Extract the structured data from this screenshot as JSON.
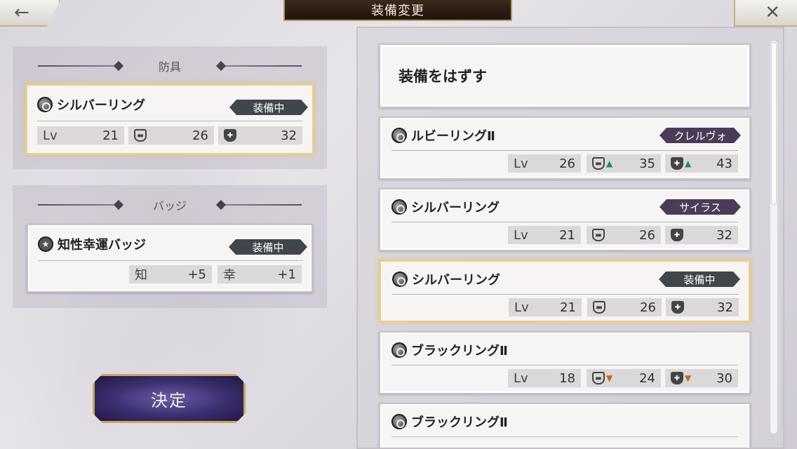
{
  "header": {
    "title": "装備変更",
    "back_icon": "←",
    "close_icon": "✕"
  },
  "armor_section": {
    "title": "防具",
    "card": {
      "name": "シルバーリング",
      "tag": "装備中",
      "lv_label": "Lv",
      "lv": "21",
      "def": "26",
      "mdef": "32"
    }
  },
  "badge_section": {
    "title": "バッジ",
    "card": {
      "name": "知性幸運バッジ",
      "tag": "装備中",
      "stat1_label": "知",
      "stat1_value": "+5",
      "stat2_label": "幸",
      "stat2_value": "+1"
    }
  },
  "decide_button": "決定",
  "list": {
    "unequip_label": "装備をはずす",
    "items": [
      {
        "name": "ルビーリングⅡ",
        "tag": "クレルヴォ",
        "tag_type": "char",
        "lv": "26",
        "def": "35",
        "def_trend": "▲",
        "mdef": "43",
        "mdef_trend": "▲"
      },
      {
        "name": "シルバーリング",
        "tag": "サイラス",
        "tag_type": "char",
        "lv": "21",
        "def": "26",
        "def_trend": "",
        "mdef": "32",
        "mdef_trend": ""
      },
      {
        "name": "シルバーリング",
        "tag": "装備中",
        "tag_type": "equip",
        "lv": "21",
        "def": "26",
        "def_trend": "",
        "mdef": "32",
        "mdef_trend": ""
      },
      {
        "name": "ブラックリングⅡ",
        "tag": "",
        "tag_type": "",
        "lv": "18",
        "def": "24",
        "def_trend": "▼",
        "mdef": "30",
        "mdef_trend": "▼"
      },
      {
        "name": "ブラックリングⅡ",
        "tag": "",
        "tag_type": "",
        "lv": "",
        "def": "",
        "def_trend": "",
        "mdef": "",
        "mdef_trend": ""
      }
    ],
    "lv_label": "Lv"
  },
  "colors": {
    "equip_tag": "#3f464c",
    "char_tag": "#4a3b57",
    "up_arrow": "#1f8a5a",
    "down_arrow": "#c26a1a",
    "equipped_border": "#e8cf8a"
  }
}
